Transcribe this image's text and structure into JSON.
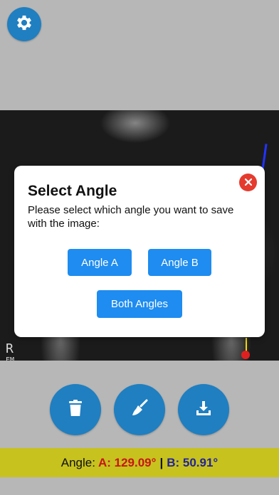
{
  "settings": {
    "icon": "gear-icon"
  },
  "xray": {
    "marker_letter": "R",
    "marker_sub": "EM"
  },
  "modal": {
    "title": "Select Angle",
    "text": "Please select which angle you want to save with the image:",
    "buttons": {
      "angle_a": "Angle A",
      "angle_b": "Angle B",
      "both": "Both Angles"
    },
    "close_icon": "close-icon"
  },
  "actions": [
    {
      "name": "delete",
      "icon": "trash-icon"
    },
    {
      "name": "clear",
      "icon": "broom-icon"
    },
    {
      "name": "save",
      "icon": "download-icon"
    }
  ],
  "status": {
    "label": "Angle:",
    "a_label": "A: 129.09°",
    "separator": "|",
    "b_label": "B: 50.91°"
  },
  "colors": {
    "accent": "#1f7fc1",
    "button": "#1e8cf0",
    "close": "#e53b2f",
    "status_bar": "#c7c21e",
    "angle_a": "#c81515",
    "angle_b": "#23239a"
  }
}
